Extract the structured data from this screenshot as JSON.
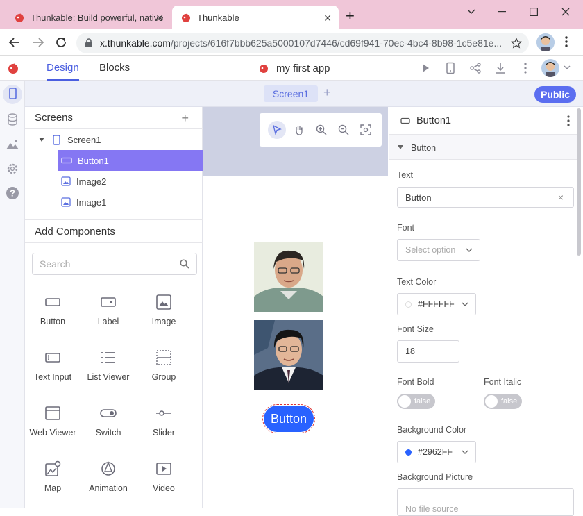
{
  "browser": {
    "tabs": [
      {
        "title": "Thunkable: Build powerful, native",
        "active": false
      },
      {
        "title": "Thunkable",
        "active": true
      }
    ],
    "url_host": "x.thunkable.com",
    "url_path": "/projects/616f7bbb625a5000107d7446/cd69f941-70ec-4bc4-8b98-1c5e81e..."
  },
  "header": {
    "tab_design": "Design",
    "tab_blocks": "Blocks",
    "app_name": "my first app"
  },
  "screenbar": {
    "screen_tab": "Screen1",
    "add_symbol": "+",
    "public_label": "Public"
  },
  "screens_panel": {
    "title": "Screens",
    "add_symbol": "+",
    "tree": [
      "Screen1",
      "Button1",
      "Image2",
      "Image1"
    ]
  },
  "components_panel": {
    "title": "Add Components",
    "search_placeholder": "Search",
    "items": [
      "Button",
      "Label",
      "Image",
      "Text Input",
      "List Viewer",
      "Group",
      "Web Viewer",
      "Switch",
      "Slider",
      "Map",
      "Animation",
      "Video"
    ]
  },
  "canvas": {
    "button_text": "Button"
  },
  "properties": {
    "component_name": "Button1",
    "section": "Button",
    "text_label": "Text",
    "text_value": "Button",
    "clear_symbol": "×",
    "font_label": "Font",
    "font_placeholder": "Select option",
    "text_color_label": "Text Color",
    "text_color_value": "#FFFFFF",
    "font_size_label": "Font Size",
    "font_size_value": "18",
    "font_bold_label": "Font Bold",
    "font_bold_value": "false",
    "font_italic_label": "Font Italic",
    "font_italic_value": "false",
    "bg_color_label": "Background Color",
    "bg_color_value": "#2962FF",
    "bg_picture_label": "Background Picture",
    "bg_picture_placeholder": "No file source"
  },
  "colors": {
    "accent": "#4a5ee0",
    "selected_row": "#8577f3",
    "button_fill": "#2962ff",
    "public": "#5b6ef0"
  }
}
